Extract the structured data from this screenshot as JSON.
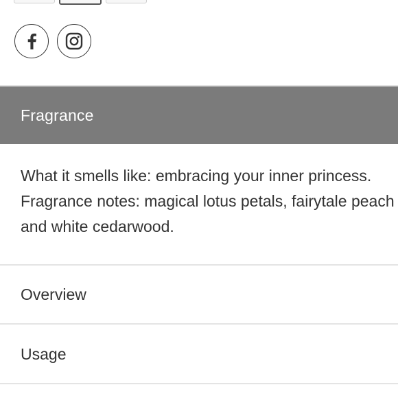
{
  "social": {
    "facebook_icon": "facebook-icon",
    "instagram_icon": "instagram-icon"
  },
  "fragrance": {
    "title": "Fragrance",
    "line1": "What it smells like: embracing your inner princess.",
    "line2": "Fragrance notes: magical lotus petals, fairytale peach",
    "line3": "and white cedarwood."
  },
  "accordion": {
    "overview_label": "Overview",
    "usage_label": "Usage"
  },
  "colors": {
    "header_bg": "#7b7b7b",
    "header_text": "#ffffff",
    "body_text": "#333333",
    "divider": "#e4e4e4"
  }
}
